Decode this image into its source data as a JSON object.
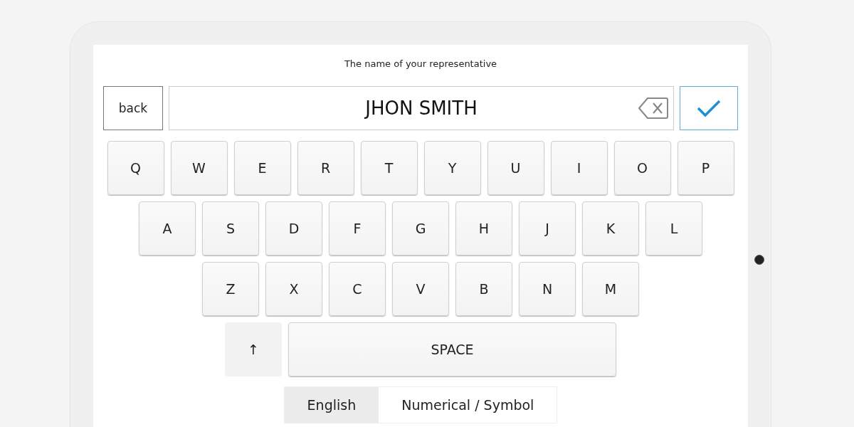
{
  "prompt": "The name of your representative",
  "back_button": "back",
  "name_field": {
    "value": "JHON SMITH"
  },
  "keyboard": {
    "rows": [
      {
        "keys": [
          {
            "kind": "letter",
            "label": "Q"
          },
          {
            "kind": "letter",
            "label": "W"
          },
          {
            "kind": "letter",
            "label": "E"
          },
          {
            "kind": "letter",
            "label": "R"
          },
          {
            "kind": "letter",
            "label": "T"
          },
          {
            "kind": "letter",
            "label": "Y"
          },
          {
            "kind": "letter",
            "label": "U"
          },
          {
            "kind": "letter",
            "label": "I"
          },
          {
            "kind": "letter",
            "label": "O"
          },
          {
            "kind": "letter",
            "label": "P"
          }
        ]
      },
      {
        "keys": [
          {
            "kind": "letter",
            "label": "A"
          },
          {
            "kind": "letter",
            "label": "S"
          },
          {
            "kind": "letter",
            "label": "D"
          },
          {
            "kind": "letter",
            "label": "F"
          },
          {
            "kind": "letter",
            "label": "G"
          },
          {
            "kind": "letter",
            "label": "H"
          },
          {
            "kind": "letter",
            "label": "J"
          },
          {
            "kind": "letter",
            "label": "K"
          },
          {
            "kind": "letter",
            "label": "L"
          }
        ]
      },
      {
        "keys": [
          {
            "kind": "letter",
            "label": "Z"
          },
          {
            "kind": "letter",
            "label": "X"
          },
          {
            "kind": "letter",
            "label": "C"
          },
          {
            "kind": "letter",
            "label": "V"
          },
          {
            "kind": "letter",
            "label": "B"
          },
          {
            "kind": "letter",
            "label": "N"
          },
          {
            "kind": "letter",
            "label": "M"
          }
        ]
      },
      {
        "keys": [
          {
            "kind": "shift",
            "label": "↑"
          },
          {
            "kind": "space",
            "label": "SPACE"
          }
        ]
      }
    ]
  },
  "layout_tabs": [
    {
      "label": "English",
      "selected": true
    },
    {
      "label": "Numerical / Symbol",
      "selected": false
    }
  ]
}
